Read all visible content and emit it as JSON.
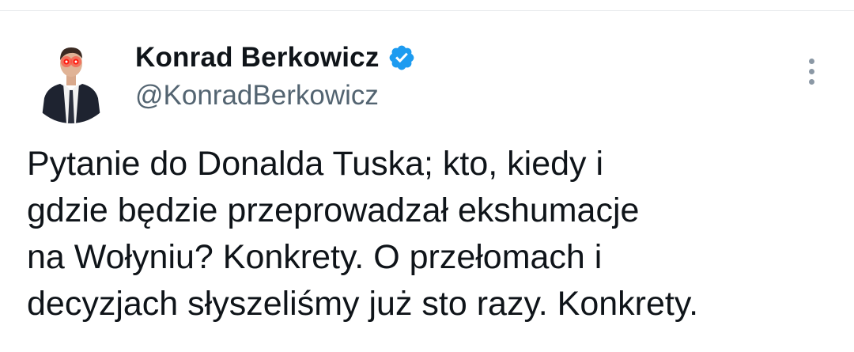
{
  "tweet": {
    "author": {
      "display_name": "Konrad Berkowicz",
      "handle": "@KonradBerkowicz",
      "verified_icon": "verified-badge-icon",
      "verified_color": "#1d9bf0"
    },
    "more_icon": "more-vertical-icon",
    "text_lines": [
      "Pytanie do Donalda Tuska; kto, kiedy i",
      "gdzie będzie przeprowadzał ekshumacje",
      "na Wołyniu? Konkrety. O przełomach i",
      "decyzjach słyszeliśmy już sto razy. Konkrety."
    ]
  }
}
